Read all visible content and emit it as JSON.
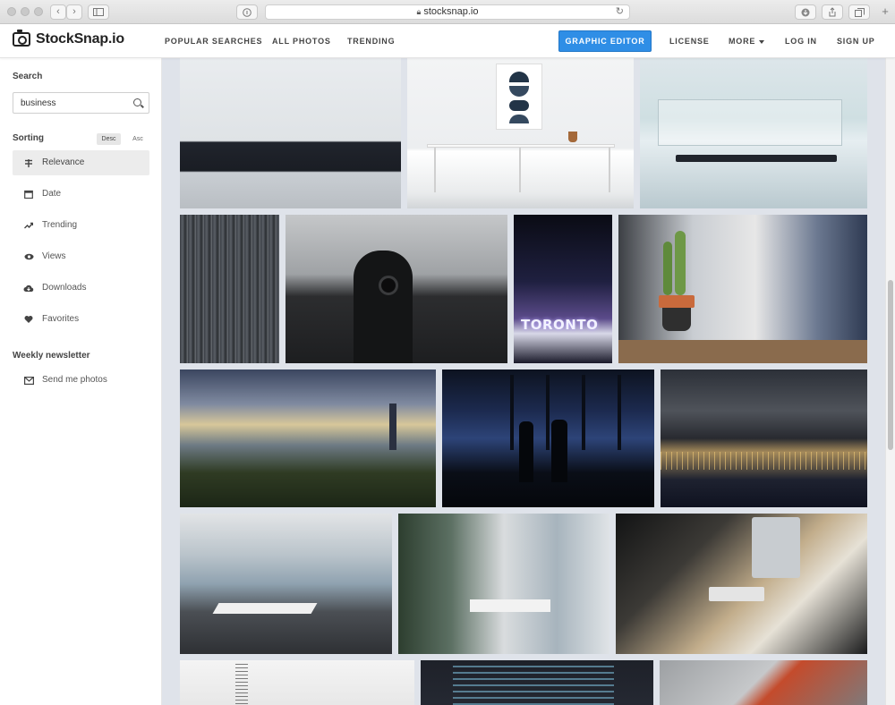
{
  "browser": {
    "url": "stocksnap.io",
    "controls": {
      "back": "‹",
      "forward": "›"
    }
  },
  "header": {
    "site_name": "StockSnap.io",
    "nav": {
      "popular": "POPULAR SEARCHES",
      "all_photos": "ALL PHOTOS",
      "trending": "TRENDING",
      "graphic_editor": "GRAPHIC EDITOR",
      "license": "LICENSE",
      "more": "MORE",
      "login": "LOG IN",
      "signup": "SIGN UP"
    },
    "accent_color": "#2f8ee6"
  },
  "sidebar": {
    "search_label": "Search",
    "search_value": "business",
    "sorting_label": "Sorting",
    "sort_desc": "Desc",
    "sort_asc": "Asc",
    "sort_items": [
      {
        "label": "Relevance",
        "icon": "relevance-icon",
        "active": true
      },
      {
        "label": "Date",
        "icon": "calendar-icon",
        "active": false
      },
      {
        "label": "Trending",
        "icon": "trending-icon",
        "active": false
      },
      {
        "label": "Views",
        "icon": "eye-icon",
        "active": false
      },
      {
        "label": "Downloads",
        "icon": "cloud-download-icon",
        "active": false
      },
      {
        "label": "Favorites",
        "icon": "heart-icon",
        "active": false
      }
    ],
    "newsletter_label": "Weekly newsletter",
    "newsletter_item": {
      "label": "Send me photos",
      "icon": "envelope-icon"
    }
  },
  "photos": [
    {
      "name": "white-conference-room",
      "bg": "linear-gradient(180deg,#e9ecef 0%,#dfe3e6 55%,#20242c 56%,#1a1d24 75%,#c9ced3 76%,#b9bec3 100%)"
    },
    {
      "name": "white-desk-art",
      "bg": "linear-gradient(180deg,#f3f4f5 0%,#eceef0 60%,#ffffff 62%,#e9ebec 90%,#d2d5d8 100%)"
    },
    {
      "name": "glass-meeting-room",
      "bg": "linear-gradient(180deg,#dde6ea 0%,#cfdfe2 40%,#e6eef1 55%,#b9c9cf 100%)"
    },
    {
      "name": "skyscraper-facade",
      "bg": "repeating-linear-gradient(90deg,#3b3f45 0px,#5a5f66 3px,#2a2d31 6px,#6a6f75 9px)"
    },
    {
      "name": "photographer-office",
      "bg": "linear-gradient(180deg,#c5c7c9 0%,#9fa2a5 40%,#2c2d2f 55%,#1d1e20 100%)"
    },
    {
      "name": "toronto-sign-night",
      "bg": "linear-gradient(180deg,#0a0b14 0%,#1f2040 45%,#5b4b8a 70%,#d8d8e8 80%,#1a1a2a 100%)"
    },
    {
      "name": "cactus-clothes-rack",
      "bg": "linear-gradient(90deg,#3c3f44 0%,#c9cdd2 30%,#e7e7e7 55%,#6b7890 80%,#2e3a52 100%)"
    },
    {
      "name": "taipei-skyline-sunset",
      "bg": "linear-gradient(180deg,#3b4660 0%,#7f8aa0 25%,#d7c79a 40%,#6d7a84 55%,#2f3b23 75%,#1c2616 100%)"
    },
    {
      "name": "couple-window-night",
      "bg": "linear-gradient(180deg,#0d1320 0%,#1c2a4f 30%,#2d4478 50%,#0a0e17 75%,#05070b 100%)"
    },
    {
      "name": "city-night-aerial",
      "bg": "linear-gradient(180deg,#2c3038 0%,#4f535a 30%,#282a30 50%,#a58a5a 60%,#1e2230 80%,#0f1220 100%)"
    },
    {
      "name": "boardroom-windows-1",
      "bg": "linear-gradient(180deg,#e2e4e6 0%,#b9c3ca 30%,#8fa2b0 50%,#4b4f54 70%,#2e3034 100%)"
    },
    {
      "name": "boardroom-windows-2",
      "bg": "linear-gradient(90deg,#2d3e2f 0%,#5c7063 25%,#d9dcde 50%,#a7b4bd 75%,#dfe3e6 100%)"
    },
    {
      "name": "vintage-desk-imac",
      "bg": "linear-gradient(135deg,#121314 0%,#3c3a36 30%,#c2ad8b 55%,#e6e1d6 70%,#1a1b1c 100%)"
    },
    {
      "name": "code-on-paper",
      "bg": "linear-gradient(180deg,#f4f4f4 0%,#e5e5e5 100%)"
    },
    {
      "name": "code-screen",
      "bg": "linear-gradient(180deg,#1e2129 0%,#262a34 100%)"
    },
    {
      "name": "red-book-desk",
      "bg": "linear-gradient(135deg,#9da0a3 0%,#c6c8ca 45%,#c44b2c 55%,#7a7d80 100%)"
    }
  ]
}
